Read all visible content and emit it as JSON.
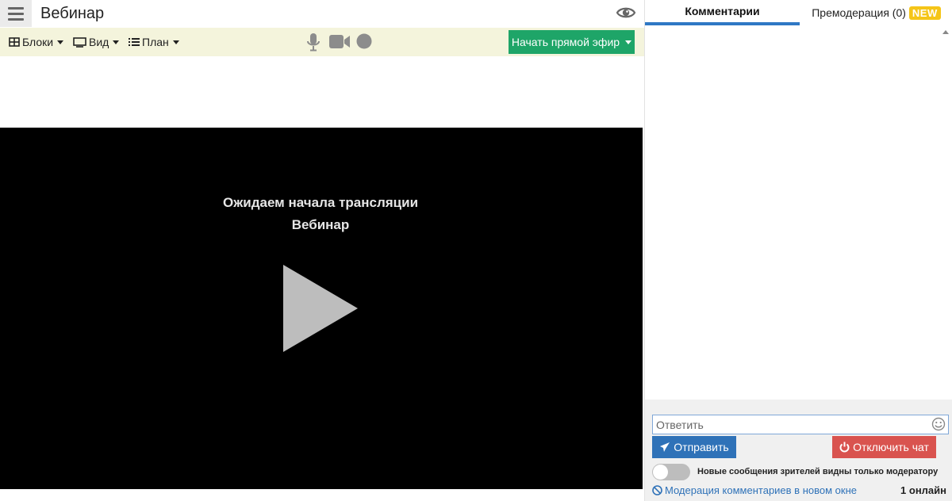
{
  "header": {
    "title": "Вебинар",
    "menu_icon": "hamburger-menu-icon",
    "preview_icon": "eye-icon"
  },
  "toolbar": {
    "blocks_label": "Блоки",
    "view_label": "Вид",
    "plan_label": "План",
    "mic_icon": "microphone-icon",
    "camera_icon": "video-camera-icon",
    "record_icon": "record-icon",
    "live_button_label": "Начать прямой эфир"
  },
  "player": {
    "status_text": "Ожидаем начала трансляции",
    "webinar_name": "Вебинар",
    "play_icon": "play-icon"
  },
  "chat": {
    "tabs": [
      {
        "label": "Комментарии",
        "active": true
      },
      {
        "label": "Премодерация (0)",
        "badge": "NEW",
        "active": false
      }
    ],
    "reply_placeholder": "Ответить",
    "send_label": "Отправить",
    "disable_chat_label": "Отключить чат",
    "toggle_label": "Новые сообщения зрителей видны только модератору",
    "toggle_on": false,
    "moderation_link": "Модерация комментариев в новом окне",
    "online_count": "1 онлайн"
  },
  "colors": {
    "toolbar_bg": "#f4f4dc",
    "live_button": "#1ea568",
    "active_tab": "#2f78c4",
    "send_button": "#2f72b8",
    "disable_button": "#d9534f",
    "badge_new": "#f5c518"
  }
}
